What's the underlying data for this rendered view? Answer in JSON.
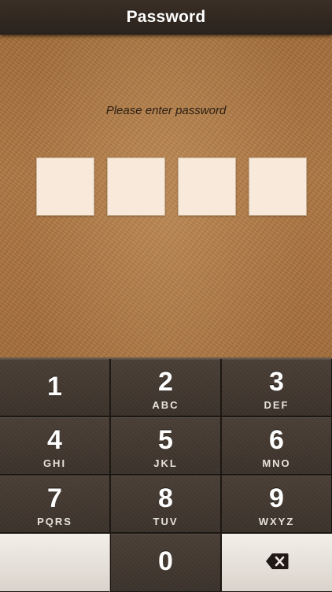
{
  "nav": {
    "title": "Password"
  },
  "prompt": "Please enter password",
  "passcode_boxes": 4,
  "keypad": {
    "rows": [
      [
        {
          "num": "1",
          "letters": ""
        },
        {
          "num": "2",
          "letters": "ABC"
        },
        {
          "num": "3",
          "letters": "DEF"
        }
      ],
      [
        {
          "num": "4",
          "letters": "GHI"
        },
        {
          "num": "5",
          "letters": "JKL"
        },
        {
          "num": "6",
          "letters": "MNO"
        }
      ],
      [
        {
          "num": "7",
          "letters": "PQRS"
        },
        {
          "num": "8",
          "letters": "TUV"
        },
        {
          "num": "9",
          "letters": "WXYZ"
        }
      ]
    ],
    "zero": "0",
    "delete_icon": "backspace-icon"
  },
  "colors": {
    "nav_bg": "#2a221c",
    "leather": "#a66f3c",
    "passcode_box": "#f8e9da",
    "key_dark": "#3b322b",
    "key_light": "#e6e0d8"
  }
}
